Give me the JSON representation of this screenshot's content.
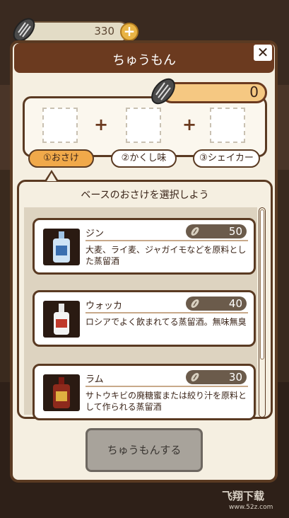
{
  "colors": {
    "dialog_bg": "#f5efe1",
    "title_bar": "#6b3a1f",
    "border": "#5a3a22",
    "active_tab": "#f0a94a",
    "order_button": "#a8a39b"
  },
  "currency": {
    "value": "330",
    "icon": "sunflower-seed-icon",
    "add_icon": "plus-icon"
  },
  "dialog": {
    "title": "ちゅうもん",
    "close_label": "✕"
  },
  "recipe": {
    "counter_value": "0",
    "plus_sign": "+",
    "tabs": [
      {
        "label": "①おさけ",
        "active": true
      },
      {
        "label": "②かくし味",
        "active": false
      },
      {
        "label": "③シェイカー",
        "active": false
      }
    ]
  },
  "list": {
    "heading": "ベースのおさけを選択しよう",
    "items": [
      {
        "name": "ジン",
        "price": "50",
        "description": "大麦、ライ麦、ジャガイモなどを原料とした蒸留酒",
        "bottle": "gin-bottle-icon"
      },
      {
        "name": "ウォッカ",
        "price": "40",
        "description": "ロシアでよく飲まれてる蒸留酒。無味無臭",
        "bottle": "vodka-bottle-icon"
      },
      {
        "name": "ラム",
        "price": "30",
        "description": "サトウキビの廃糖蜜または絞り汁を原料として作られる蒸留酒",
        "bottle": "rum-bottle-icon"
      }
    ]
  },
  "order_button": {
    "label": "ちゅうもんする"
  },
  "watermark": {
    "text": "飞翔下载",
    "sub": "www.52z.com"
  }
}
